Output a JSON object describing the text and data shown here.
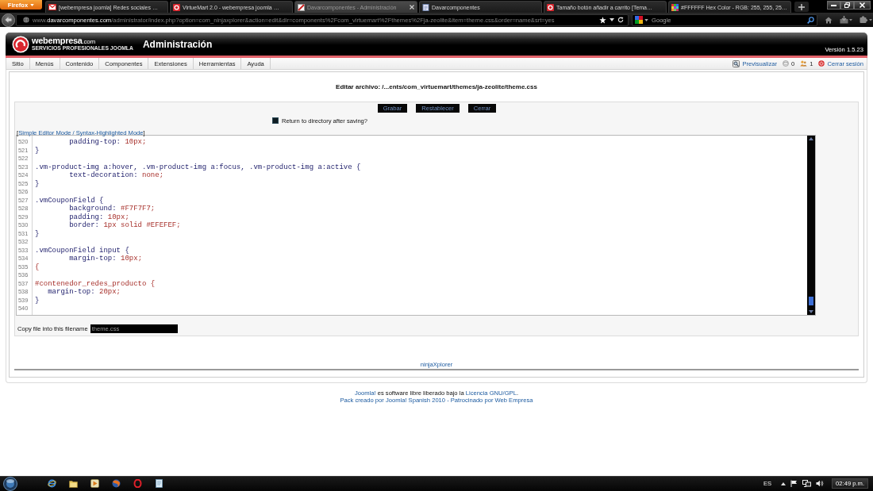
{
  "browser": {
    "menu_button": "Firefox",
    "tabs": [
      {
        "title": "[webempresa joomla] Redes sociales …",
        "selected": false
      },
      {
        "title": "VirtueMart 2.0 - webempresa joomla …",
        "selected": false
      },
      {
        "title": "Davarcomponentes - Administración",
        "selected": true
      },
      {
        "title": "Davarcomponentes",
        "selected": false
      },
      {
        "title": "Tamaño botón añadir a carrito [Tema…",
        "selected": false
      },
      {
        "title": "#FFFFFF Hex Color - RGB: 255, 255, 25…",
        "selected": false
      }
    ],
    "address": {
      "prefix": "www.",
      "domain": "davarcomponentes.com",
      "path": "/administrator/index.php?option=com_ninjaxplorer&action=edit&dir=components%2Fcom_virtuemart%2Fthemes%2Fja-zeolite&item=theme.css&order=name&srt=yes"
    },
    "search": {
      "placeholder": "Google"
    }
  },
  "header": {
    "brand": "webempresa",
    "brand_suffix": ".com",
    "tagline": "SERVICIOS PROFESIONALES JOOMLA",
    "title": "Administración",
    "version": "Versión 1.5.23"
  },
  "menu": {
    "items": [
      "Sitio",
      "Menús",
      "Contenido",
      "Componentes",
      "Extensiones",
      "Herramientas",
      "Ayuda"
    ],
    "status": [
      {
        "label": "Previsualizar",
        "kind": "link"
      },
      {
        "label": "0",
        "kind": "count"
      },
      {
        "label": "1",
        "kind": "count"
      },
      {
        "label": "Cerrar sesión",
        "kind": "link"
      }
    ]
  },
  "editor": {
    "heading": "Editar archivo: /...ents/com_virtuemart/themes/ja-zeolite/theme.css",
    "buttons": [
      "Grabar",
      "Restablecer",
      "Cerrar"
    ],
    "return_option": {
      "label": "Return to directory after saving?",
      "checked": false
    },
    "mode_switch": {
      "before": "[",
      "link": "Simple Editor Mode / Syntax-Highlighted Mode",
      "after": "]"
    },
    "code_lines": [
      {
        "number": "520",
        "tokens": [
          {
            "text": "        padding-top:",
            "kind": "property"
          },
          {
            "text": " 10px;",
            "kind": "value"
          }
        ]
      },
      {
        "number": "521",
        "tokens": [
          {
            "text": "}",
            "kind": "punct"
          }
        ]
      },
      {
        "number": "522"
      },
      {
        "number": "523",
        "tokens": [
          {
            "text": ".vm-product-img a:hover, .vm-product-img a:focus, .vm-product-img a:active {",
            "kind": "selector"
          }
        ]
      },
      {
        "number": "524",
        "tokens": [
          {
            "text": "        text-decoration:",
            "kind": "property"
          },
          {
            "text": " none;",
            "kind": "value"
          }
        ]
      },
      {
        "number": "525",
        "tokens": [
          {
            "text": "}",
            "kind": "punct"
          }
        ]
      },
      {
        "number": "526"
      },
      {
        "number": "527",
        "tokens": [
          {
            "text": ".vmCouponField {",
            "kind": "selector"
          }
        ]
      },
      {
        "number": "528",
        "tokens": [
          {
            "text": "        background:",
            "kind": "property"
          },
          {
            "text": " #F7F7F7;",
            "kind": "value"
          }
        ]
      },
      {
        "number": "529",
        "tokens": [
          {
            "text": "        padding:",
            "kind": "property"
          },
          {
            "text": " 10px;",
            "kind": "value"
          }
        ]
      },
      {
        "number": "530",
        "tokens": [
          {
            "text": "        border:",
            "kind": "property"
          },
          {
            "text": " 1px solid #EFEFEF;",
            "kind": "value"
          }
        ]
      },
      {
        "number": "531",
        "tokens": [
          {
            "text": "}",
            "kind": "punct"
          }
        ]
      },
      {
        "number": "532"
      },
      {
        "number": "533",
        "tokens": [
          {
            "text": ".vmCouponField input {",
            "kind": "selector"
          }
        ]
      },
      {
        "number": "534",
        "tokens": [
          {
            "text": "        margin-top:",
            "kind": "property"
          },
          {
            "text": " 10px;",
            "kind": "value"
          }
        ]
      },
      {
        "number": "535",
        "tokens": [
          {
            "text": "{",
            "kind": "invalid"
          }
        ]
      },
      {
        "number": "536"
      },
      {
        "number": "537",
        "tokens": [
          {
            "text": "#contenedor_redes_producto {",
            "kind": "id"
          }
        ]
      },
      {
        "number": "538",
        "tokens": [
          {
            "text": "   margin-top:",
            "kind": "property"
          },
          {
            "text": " 20px;",
            "kind": "value"
          }
        ]
      },
      {
        "number": "539",
        "tokens": [
          {
            "text": "}",
            "kind": "punct"
          }
        ]
      },
      {
        "number": "540"
      }
    ],
    "copy": {
      "label": "Copy file into this filename",
      "value": "theme.css"
    },
    "module_link": "ninjaXplorer"
  },
  "footer": {
    "license": [
      {
        "text": "Joomla!",
        "kind": "link"
      },
      {
        "text": " es software libre liberado bajo la ",
        "kind": "text"
      },
      {
        "text": "Licencia GNU/GPL",
        "kind": "link"
      },
      {
        "text": ".",
        "kind": "text"
      }
    ],
    "credits": "Pack creado por Joomla! Spanish 2010 - Patrocinado por Web Empresa"
  },
  "taskbar": {
    "language": "ES",
    "clock": "02:49 p.m."
  }
}
